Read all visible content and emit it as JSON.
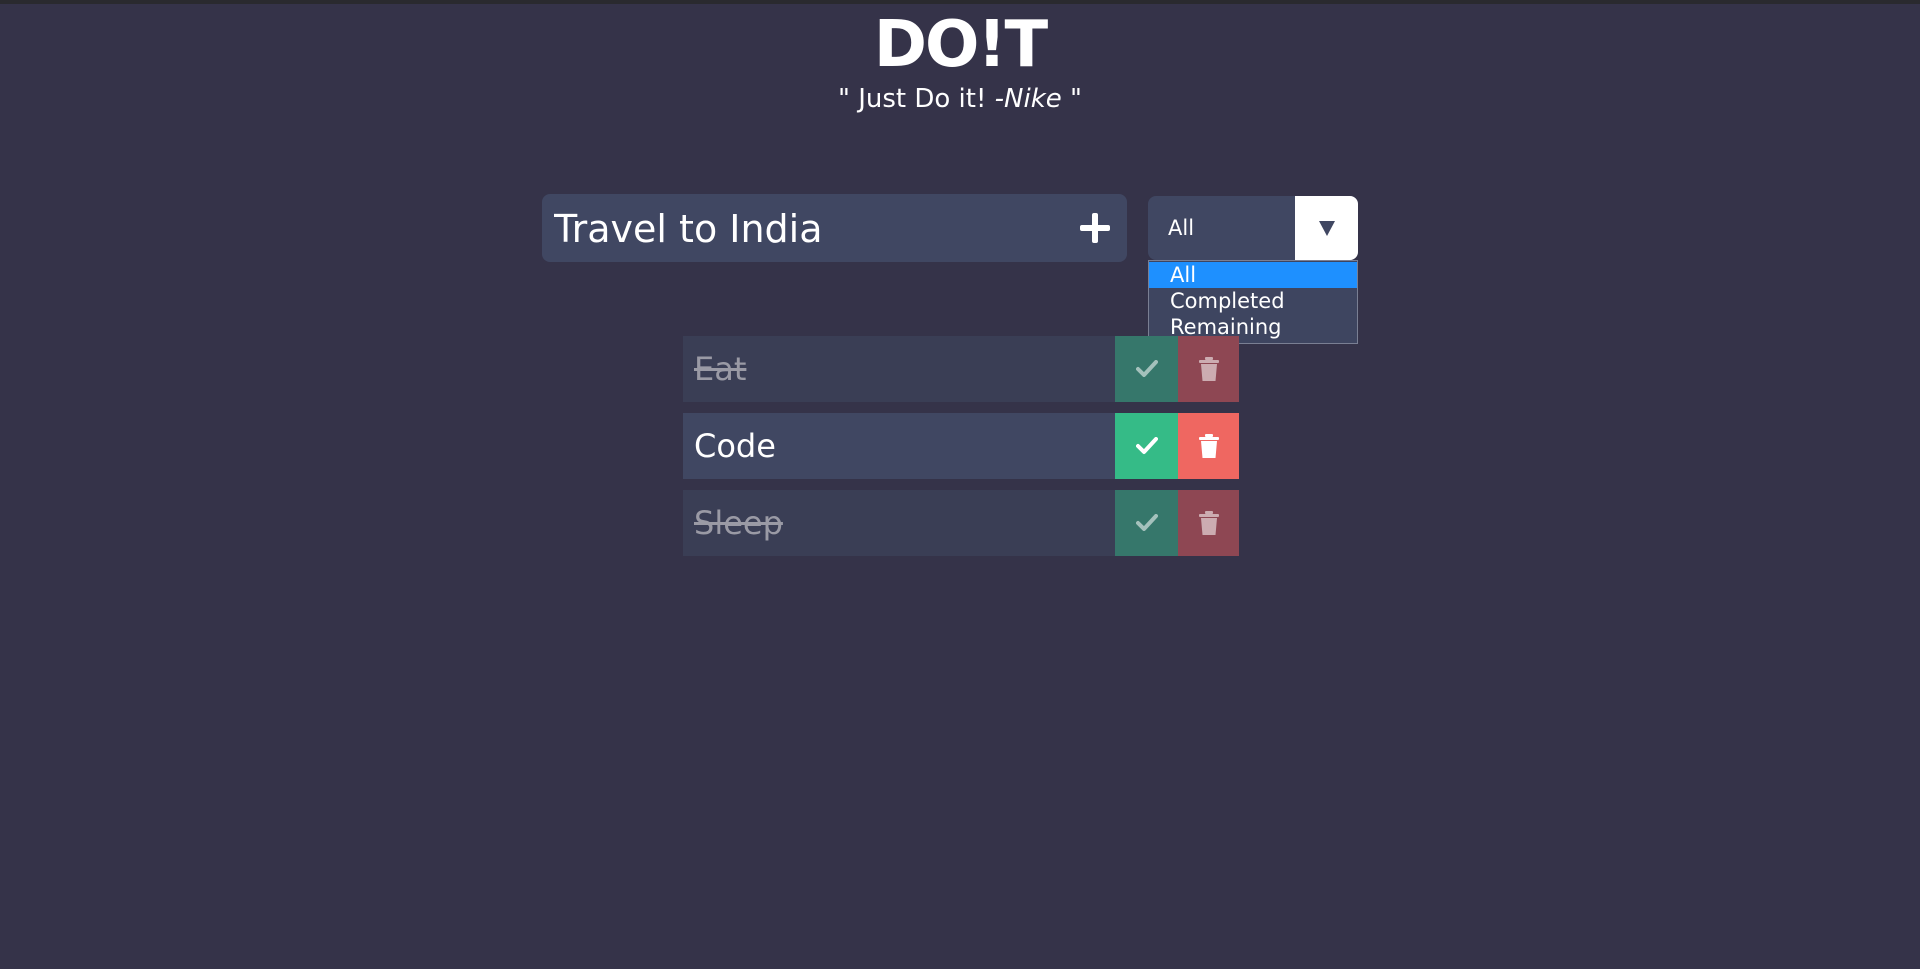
{
  "app": {
    "title": "DO!T",
    "tagline_prefix": "\" Just Do it! ",
    "tagline_author": "-Nike",
    "tagline_suffix": " \""
  },
  "new_todo": {
    "value": "Travel to India",
    "add_icon": "plus-icon"
  },
  "filter": {
    "selected": "All",
    "options": [
      "All",
      "Completed",
      "Remaining"
    ],
    "highlight_color": "#1e90ff"
  },
  "todos": [
    {
      "text": "Eat",
      "completed": true
    },
    {
      "text": "Code",
      "completed": false
    },
    {
      "text": "Sleep",
      "completed": true
    }
  ],
  "colors": {
    "background": "#353349",
    "panel": "#404762",
    "complete": "#35bb87",
    "delete": "#ef6761"
  },
  "icons": {
    "complete": "check-icon",
    "delete": "trash-icon",
    "filter_toggle": "caret-down-icon"
  }
}
